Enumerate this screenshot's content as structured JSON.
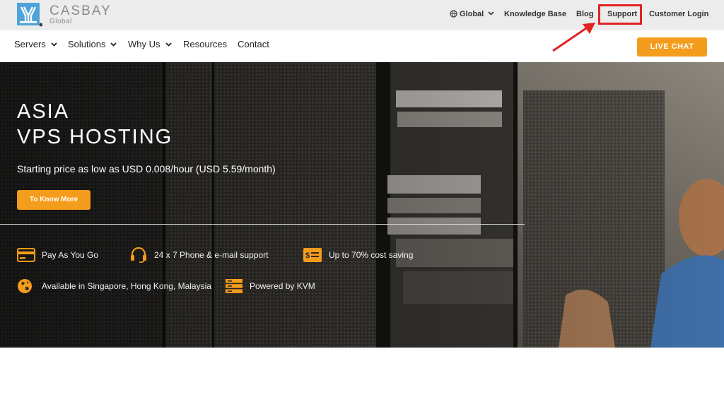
{
  "brand": {
    "name": "CASBAY",
    "tagline": "Global",
    "logo_icon": "casbay-logo-icon"
  },
  "utility_nav": {
    "global_label": "Global",
    "knowledge_base_label": "Knowledge Base",
    "blog_label": "Blog",
    "support_label": "Support",
    "customer_login_label": "Customer Login"
  },
  "main_nav": {
    "items": [
      {
        "label": "Servers",
        "has_dropdown": true
      },
      {
        "label": "Solutions",
        "has_dropdown": true
      },
      {
        "label": "Why Us",
        "has_dropdown": true
      },
      {
        "label": "Resources",
        "has_dropdown": false
      },
      {
        "label": "Contact",
        "has_dropdown": false
      }
    ],
    "live_chat_label": "LIVE CHAT"
  },
  "hero": {
    "title_line1": "ASIA",
    "title_line2": "VPS HOSTING",
    "subtitle": "Starting price as low as USD 0.008/hour (USD 5.59/month)",
    "cta_label": "To Know More",
    "features": [
      {
        "icon": "credit-card-icon",
        "label": "Pay As You Go"
      },
      {
        "icon": "headset-icon",
        "label": "24 x 7 Phone & e-mail support"
      },
      {
        "icon": "dollar-bill-icon",
        "label": "Up to 70% cost saving"
      },
      {
        "icon": "globe-icon",
        "label": "Available in Singapore, Hong Kong, Malaysia"
      },
      {
        "icon": "server-stack-icon",
        "label": "Powered by KVM"
      }
    ]
  },
  "colors": {
    "accent": "#f49c1b",
    "highlight_box": "#e22222",
    "topbar_bg": "#ececec"
  }
}
